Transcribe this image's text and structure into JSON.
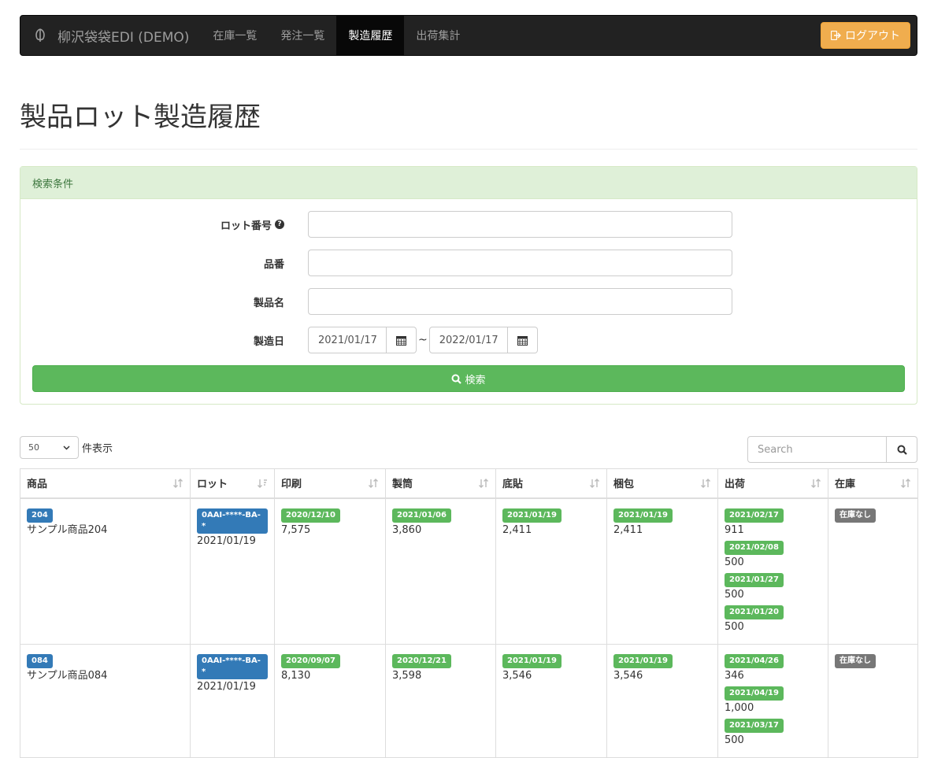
{
  "navbar": {
    "brand": "柳沢袋袋EDI (DEMO)",
    "items": [
      {
        "label": "在庫一覧"
      },
      {
        "label": "発注一覧"
      },
      {
        "label": "製造履歴"
      },
      {
        "label": "出荷集計"
      }
    ],
    "active_item": "製造履歴",
    "logout_label": "ログアウト"
  },
  "page": {
    "title": "製品ロット製造履歴"
  },
  "search_panel": {
    "heading": "検索条件",
    "lot_number_label": "ロット番号",
    "lot_number_value": "",
    "part_number_label": "品番",
    "part_number_value": "",
    "product_name_label": "製品名",
    "product_name_value": "",
    "manufacture_date_label": "製造日",
    "date_from": "2021/01/17",
    "date_separator": "~",
    "date_to": "2022/01/17",
    "search_button": "検索"
  },
  "table_controls": {
    "page_length": "50",
    "page_length_label": "件表示",
    "search_placeholder": "Search"
  },
  "table": {
    "columns": [
      "商品",
      "ロット",
      "印刷",
      "製筒",
      "底貼",
      "梱包",
      "出荷",
      "在庫"
    ],
    "rows": [
      {
        "product_code": "204",
        "product_name": "サンプル商品204",
        "lot_code": "0AAI-****-BA-*",
        "lot_date": "2021/01/19",
        "print_date": "2020/12/10",
        "print_qty": "7,575",
        "tube_date": "2021/01/06",
        "tube_qty": "3,860",
        "bottom_date": "2021/01/19",
        "bottom_qty": "2,411",
        "pack_date": "2021/01/19",
        "pack_qty": "2,411",
        "shipments": [
          {
            "date": "2021/02/17",
            "qty": "911"
          },
          {
            "date": "2021/02/08",
            "qty": "500"
          },
          {
            "date": "2021/01/27",
            "qty": "500"
          },
          {
            "date": "2021/01/20",
            "qty": "500"
          }
        ],
        "stock": "在庫なし"
      },
      {
        "product_code": "084",
        "product_name": "サンプル商品084",
        "lot_code": "0AAI-****-BA-*",
        "lot_date": "2021/01/19",
        "print_date": "2020/09/07",
        "print_qty": "8,130",
        "tube_date": "2020/12/21",
        "tube_qty": "3,598",
        "bottom_date": "2021/01/19",
        "bottom_qty": "3,546",
        "pack_date": "2021/01/19",
        "pack_qty": "3,546",
        "shipments": [
          {
            "date": "2021/04/26",
            "qty": "346"
          },
          {
            "date": "2021/04/19",
            "qty": "1,000"
          },
          {
            "date": "2021/03/17",
            "qty": "500"
          }
        ],
        "stock": "在庫なし"
      }
    ]
  },
  "colors": {
    "navbar_bg": "#222222",
    "logout_btn": "#f0ad4e",
    "search_btn": "#5cb85c",
    "badge_blue": "#337ab7",
    "badge_green": "#5cb85c",
    "badge_gray": "#777777"
  },
  "icons": [
    "logo-icon",
    "signout-icon",
    "question-circle-icon",
    "calendar-icon",
    "search-icon",
    "sort-icon"
  ]
}
